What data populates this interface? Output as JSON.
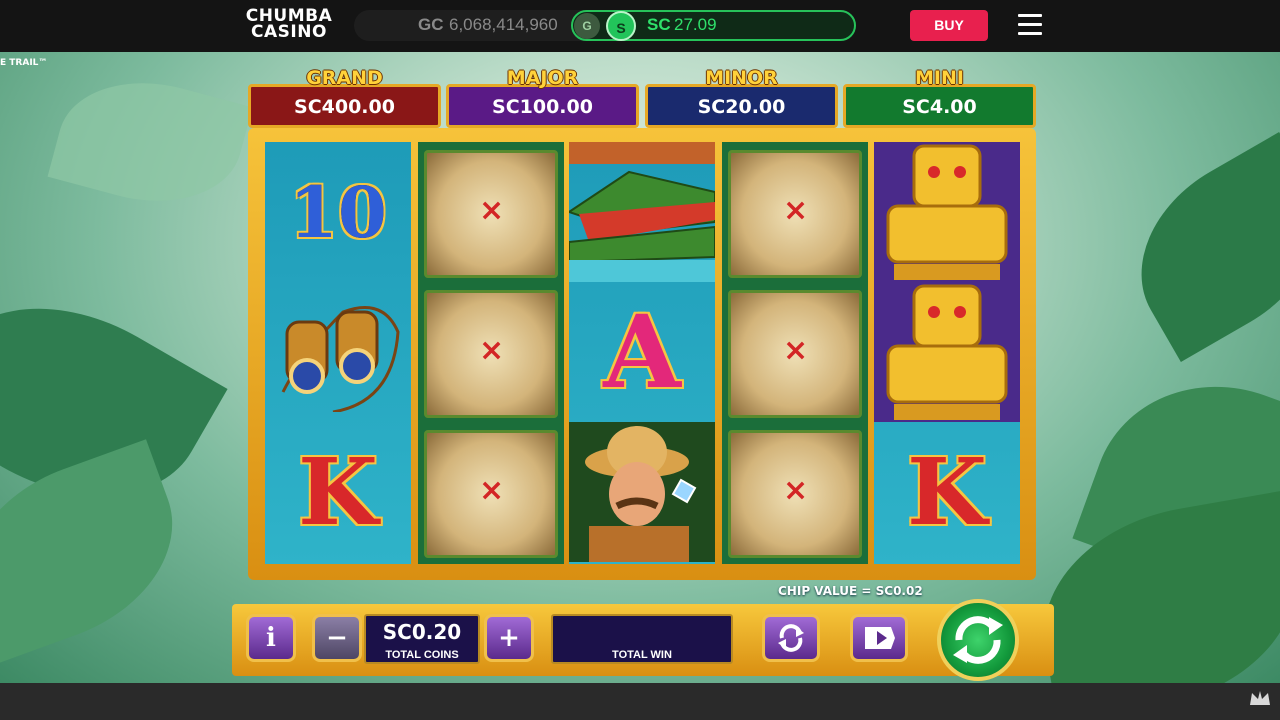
{
  "header": {
    "logo_line1": "CHUMBA",
    "logo_line2": "CASINO",
    "gc_label": "GC",
    "gc_value": "6,068,414,960",
    "toggle_g": "G",
    "toggle_s": "S",
    "sc_label": "SC",
    "sc_value": "27.09",
    "buy_label": "BUY",
    "menu_icon": "hamburger-menu-icon"
  },
  "game": {
    "title_fragment": "E TRAIL™",
    "jackpots": [
      {
        "title": "GRAND",
        "value": "SC400.00",
        "color": "#8a1717"
      },
      {
        "title": "MAJOR",
        "value": "SC100.00",
        "color": "#5a1a86"
      },
      {
        "title": "MINOR",
        "value": "SC20.00",
        "color": "#1a2a6e"
      },
      {
        "title": "MINI",
        "value": "SC4.00",
        "color": "#127a2e"
      }
    ],
    "reels": [
      [
        "10",
        "binoculars",
        "K"
      ],
      [
        "map",
        "map",
        "map"
      ],
      [
        "crocodile",
        "A",
        "explorer"
      ],
      [
        "map",
        "map",
        "map"
      ],
      [
        "idol",
        "idol",
        "K"
      ]
    ],
    "symbol_text": {
      "ten": "10",
      "king": "K",
      "ace": "A",
      "map_x": "×"
    },
    "chip_value": "CHIP VALUE = SC0.02"
  },
  "console": {
    "info_label": "i",
    "minus_label": "−",
    "plus_label": "+",
    "bet_value": "SC0.20",
    "bet_caption": "TOTAL COINS",
    "win_value": "",
    "win_caption": "TOTAL WIN",
    "autoplay_icon": "autoplay-icon",
    "turbo_icon": "turbo-icon",
    "spin_icon": "spin-arrows-icon"
  },
  "footer": {
    "crown_icon": "crown-icon"
  }
}
